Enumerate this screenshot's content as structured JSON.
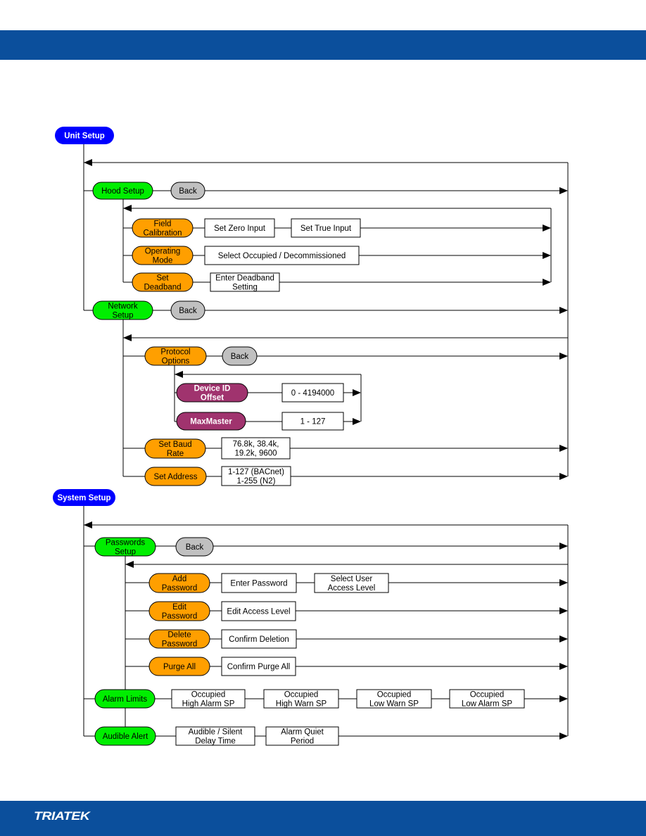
{
  "footer": {
    "logo": "TRIATEK"
  },
  "colors": {
    "band": "#0b4f9c",
    "root": "#0000ff",
    "menu": "#00ee00",
    "option": "#ff9f00",
    "protocol": "#a0336e",
    "back": "#c0c0c0",
    "box": "#ffffff"
  },
  "nodes": {
    "unit_setup": [
      "Unit Setup"
    ],
    "hood_setup": [
      "Hood Setup"
    ],
    "hood_back": [
      "Back"
    ],
    "field_cal": [
      "Field",
      "Calibration"
    ],
    "set_zero": [
      "Set Zero Input"
    ],
    "set_true": [
      "Set True Input"
    ],
    "op_mode": [
      "Operating",
      "Mode"
    ],
    "select_occ": [
      "Select Occupied / Decommissioned"
    ],
    "set_deadband": [
      "Set",
      "Deadband"
    ],
    "enter_deadband": [
      "Enter Deadband",
      "Setting"
    ],
    "network_setup": [
      "Network",
      "Setup"
    ],
    "network_back": [
      "Back"
    ],
    "protocol_options": [
      "Protocol",
      "Options"
    ],
    "protocol_back": [
      "Back"
    ],
    "device_id": [
      "Device ID",
      "Offset"
    ],
    "device_id_range": [
      "0 - 4194000"
    ],
    "maxmaster": [
      "MaxMaster"
    ],
    "maxmaster_range": [
      "1 - 127"
    ],
    "baud": [
      "Set Baud",
      "Rate"
    ],
    "baud_values": [
      "76.8k, 38.4k,",
      "19.2k, 9600"
    ],
    "address": [
      "Set Address"
    ],
    "address_values": [
      "1-127 (BACnet)",
      "1-255 (N2)"
    ],
    "system_setup": [
      "System Setup"
    ],
    "passwords": [
      "Passwords",
      "Setup"
    ],
    "passwords_back": [
      "Back"
    ],
    "add_pw": [
      "Add",
      "Password"
    ],
    "enter_pw": [
      "Enter Password"
    ],
    "select_level": [
      "Select User",
      "Access Level"
    ],
    "edit_pw": [
      "Edit",
      "Password"
    ],
    "edit_level": [
      "Edit Access Level"
    ],
    "delete_pw": [
      "Delete",
      "Password"
    ],
    "confirm_del": [
      "Confirm Deletion"
    ],
    "purge": [
      "Purge All"
    ],
    "confirm_purge": [
      "Confirm Purge All"
    ],
    "alarm_limits": [
      "Alarm Limits"
    ],
    "occ_high_alarm": [
      "Occupied",
      "High Alarm SP"
    ],
    "occ_high_warn": [
      "Occupied",
      "High Warn SP"
    ],
    "occ_low_warn": [
      "Occupied",
      "Low Warn SP"
    ],
    "occ_low_alarm": [
      "Occupied",
      "Low Alarm SP"
    ],
    "audible": [
      "Audible Alert"
    ],
    "audible_delay": [
      "Audible / Silent",
      "Delay Time"
    ],
    "quiet": [
      "Alarm Quiet",
      "Period"
    ]
  }
}
